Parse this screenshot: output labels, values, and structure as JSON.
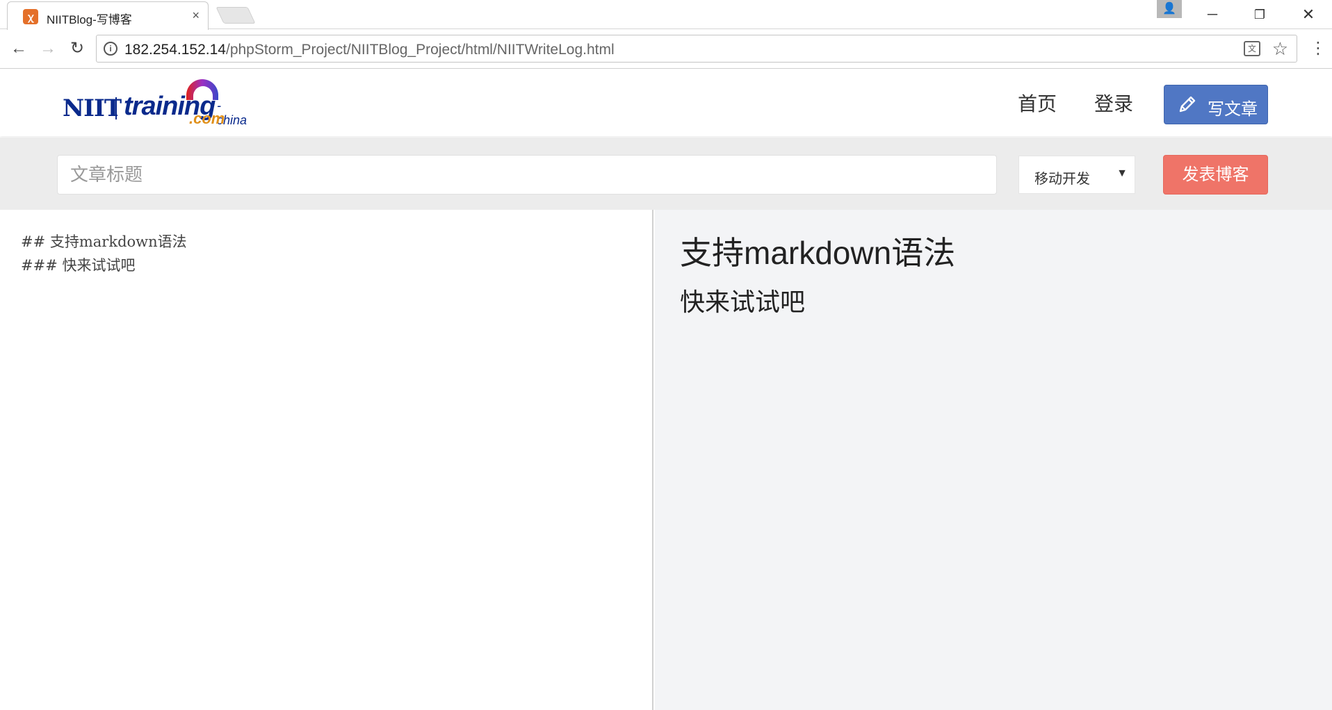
{
  "browser": {
    "tab_title": "NIITBlog-写博客",
    "tab_close": "×",
    "url_host": "182.254.152.14",
    "url_path": "/phpStorm_Project/NIITBlog_Project/html/NIITWriteLog.html",
    "icons": {
      "favicon": "xampp-icon",
      "back": "back-arrow-icon",
      "forward": "forward-arrow-icon",
      "reload": "reload-icon",
      "info": "info-icon",
      "translate": "translate-icon",
      "bookmark": "star-icon",
      "menu": "kebab-menu-icon",
      "profile": "profile-icon"
    }
  },
  "header": {
    "logo": {
      "niit": "NIIT",
      "training": "training",
      "china": "-china",
      "com": ".com"
    },
    "nav": {
      "home": "首页",
      "login": "登录"
    },
    "write_button": "写文章",
    "colors": {
      "write_button": "#5077c4"
    }
  },
  "titlebar": {
    "title_placeholder": "文章标题",
    "title_value": "",
    "category_selected": "移动开发",
    "publish_button": "发表博客",
    "colors": {
      "publish_button": "#ef7468"
    }
  },
  "editor": {
    "lines": [
      "## 支持markdown语法",
      "### 快来试试吧"
    ]
  },
  "preview": {
    "h2": "支持markdown语法",
    "h3": "快来试试吧"
  }
}
